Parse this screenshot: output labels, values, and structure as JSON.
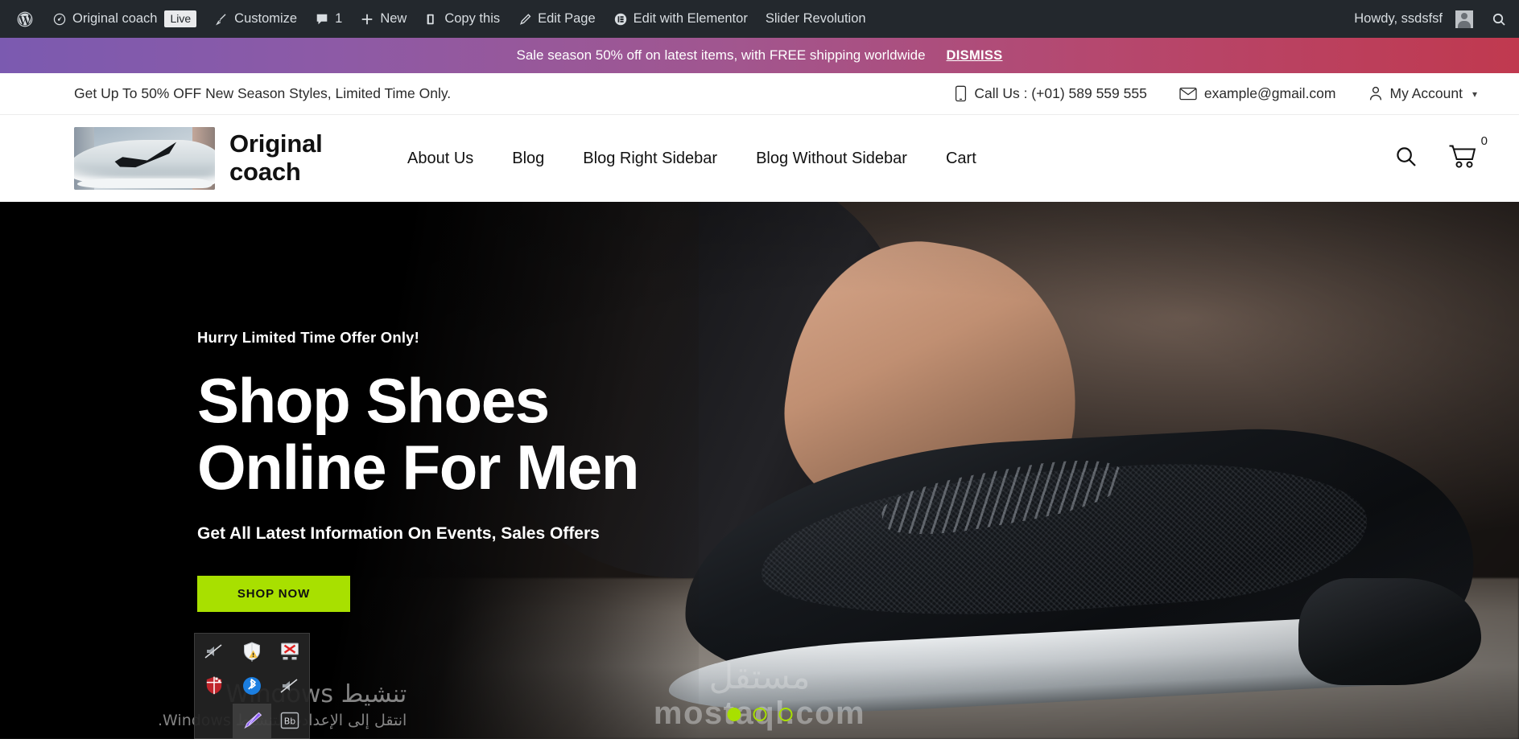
{
  "adminbar": {
    "wp_logo": "wordpress-logo-icon",
    "items": [
      {
        "label": "Original coach",
        "icon": "dashboard-icon",
        "badge": "Live"
      },
      {
        "label": "Customize",
        "icon": "paintbrush-icon"
      },
      {
        "label": "1",
        "icon": "comment-bubble-icon"
      },
      {
        "label": "New",
        "icon": "plus-icon"
      },
      {
        "label": "Copy this",
        "icon": "page-copy-icon"
      },
      {
        "label": "Edit Page",
        "icon": "pencil-icon"
      },
      {
        "label": "Edit with Elementor",
        "icon": "elementor-icon"
      },
      {
        "label": "Slider Revolution",
        "icon": "none"
      }
    ],
    "howdy": "Howdy, ssdsfsf",
    "search_icon": "search-icon"
  },
  "promo": {
    "message": "Sale season 50% off on latest items, with FREE shipping worldwide",
    "dismiss": "DISMISS",
    "gradient_from": "#7b5ab0",
    "gradient_to": "#c0394f"
  },
  "topbar": {
    "offer": "Get Up To 50% OFF New Season Styles, Limited Time Only.",
    "phone": "Call Us : (+01) 589 559 555",
    "email": "example@gmail.com",
    "account": "My Account"
  },
  "header": {
    "brand": "Original coach",
    "nav": [
      {
        "label": "About Us"
      },
      {
        "label": "Blog"
      },
      {
        "label": "Blog Right Sidebar"
      },
      {
        "label": "Blog Without Sidebar"
      },
      {
        "label": "Cart"
      }
    ],
    "cart_count": "0"
  },
  "hero": {
    "eyebrow": "Hurry Limited Time Offer Only!",
    "title_line1": "Shop Shoes",
    "title_line2": "Online For Men",
    "subtitle": "Get All Latest Information On Events, Sales Offers",
    "cta": "SHOP NOW",
    "cta_color": "#a8e000",
    "dots": [
      {
        "active": true
      },
      {
        "active": false
      },
      {
        "active": false
      }
    ]
  },
  "watermark": {
    "arabic": "مستقل",
    "latin": "mostaql.com"
  },
  "windows_activation": {
    "title": "تنشيط Windows",
    "subtitle": "انتقل إلى الإعدادت لتنشيط Windows."
  },
  "tray": {
    "icons": [
      "muted-speaker-icon",
      "security-shield-warning-icon",
      "display-disconnected-icon",
      "red-shield-icon",
      "bluetooth-icon",
      "muted-speaker-icon",
      "empty",
      "pen-highlighter-icon",
      "bb-app-icon"
    ]
  }
}
